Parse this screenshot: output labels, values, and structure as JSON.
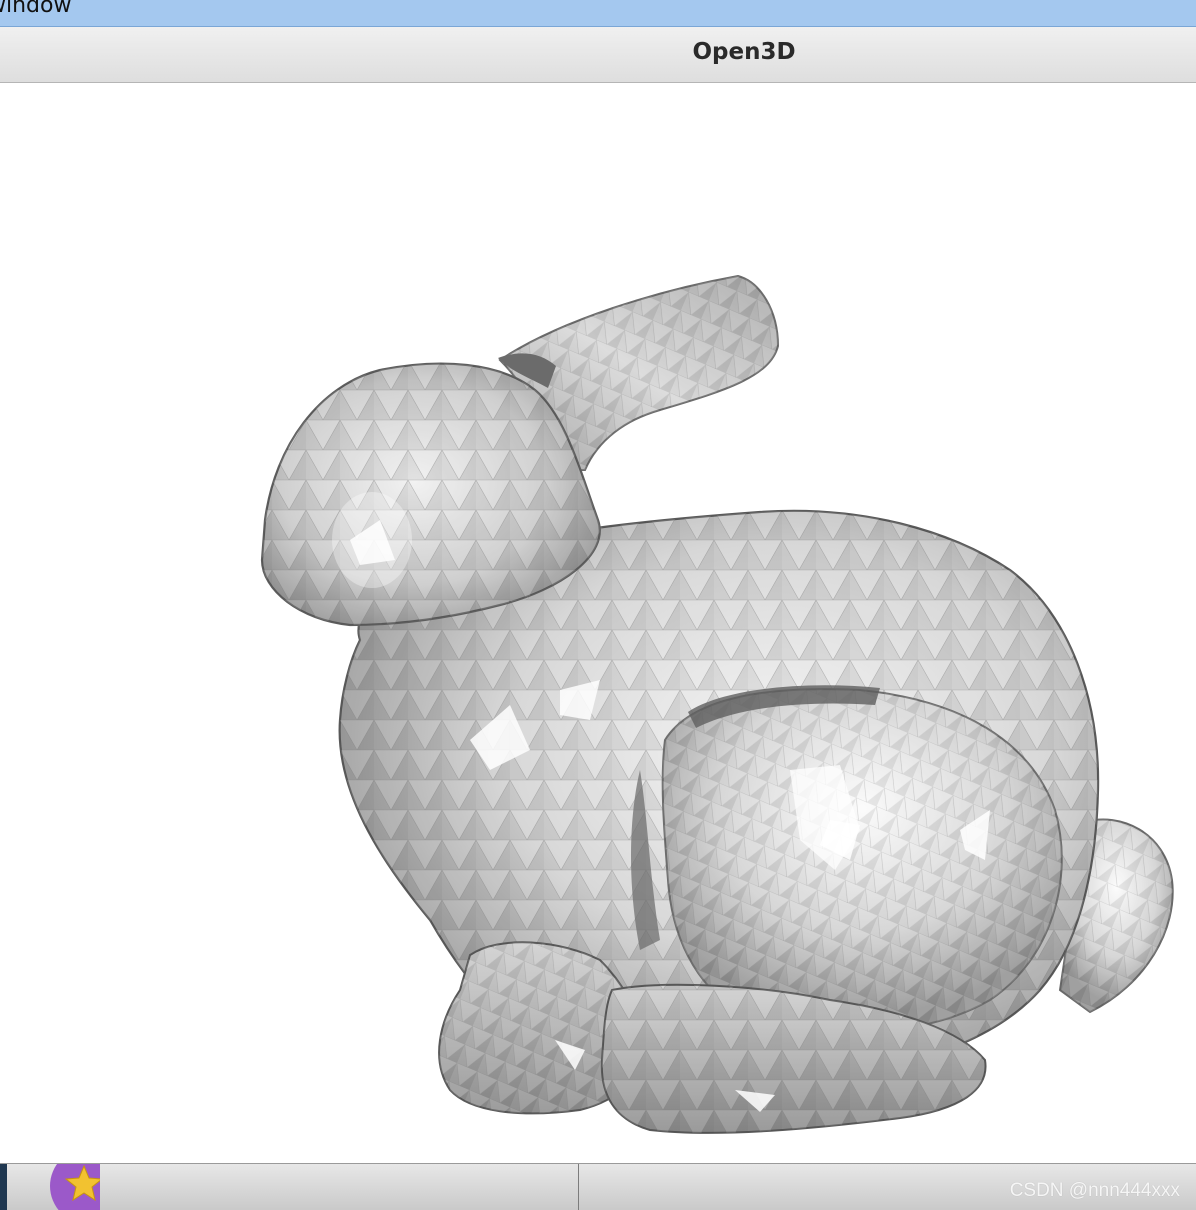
{
  "outer_window": {
    "label": "window"
  },
  "app_window": {
    "title": "Open3D"
  },
  "viewport": {
    "mesh_icon": "stanford-bunny-mesh",
    "background_color": "#ffffff",
    "mesh_color": "#c8c8c8"
  },
  "taskbar": {
    "app_icon": "star-icon",
    "watermark": "CSDN @nnn444xxx"
  }
}
